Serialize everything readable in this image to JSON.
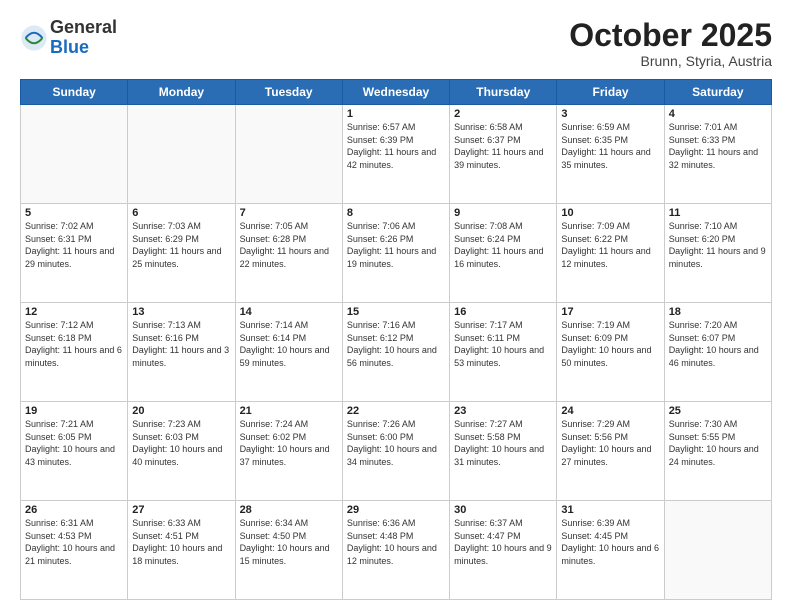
{
  "header": {
    "logo_general": "General",
    "logo_blue": "Blue",
    "month": "October 2025",
    "location": "Brunn, Styria, Austria"
  },
  "days_of_week": [
    "Sunday",
    "Monday",
    "Tuesday",
    "Wednesday",
    "Thursday",
    "Friday",
    "Saturday"
  ],
  "weeks": [
    [
      {
        "day": "",
        "info": ""
      },
      {
        "day": "",
        "info": ""
      },
      {
        "day": "",
        "info": ""
      },
      {
        "day": "1",
        "info": "Sunrise: 6:57 AM\nSunset: 6:39 PM\nDaylight: 11 hours\nand 42 minutes."
      },
      {
        "day": "2",
        "info": "Sunrise: 6:58 AM\nSunset: 6:37 PM\nDaylight: 11 hours\nand 39 minutes."
      },
      {
        "day": "3",
        "info": "Sunrise: 6:59 AM\nSunset: 6:35 PM\nDaylight: 11 hours\nand 35 minutes."
      },
      {
        "day": "4",
        "info": "Sunrise: 7:01 AM\nSunset: 6:33 PM\nDaylight: 11 hours\nand 32 minutes."
      }
    ],
    [
      {
        "day": "5",
        "info": "Sunrise: 7:02 AM\nSunset: 6:31 PM\nDaylight: 11 hours\nand 29 minutes."
      },
      {
        "day": "6",
        "info": "Sunrise: 7:03 AM\nSunset: 6:29 PM\nDaylight: 11 hours\nand 25 minutes."
      },
      {
        "day": "7",
        "info": "Sunrise: 7:05 AM\nSunset: 6:28 PM\nDaylight: 11 hours\nand 22 minutes."
      },
      {
        "day": "8",
        "info": "Sunrise: 7:06 AM\nSunset: 6:26 PM\nDaylight: 11 hours\nand 19 minutes."
      },
      {
        "day": "9",
        "info": "Sunrise: 7:08 AM\nSunset: 6:24 PM\nDaylight: 11 hours\nand 16 minutes."
      },
      {
        "day": "10",
        "info": "Sunrise: 7:09 AM\nSunset: 6:22 PM\nDaylight: 11 hours\nand 12 minutes."
      },
      {
        "day": "11",
        "info": "Sunrise: 7:10 AM\nSunset: 6:20 PM\nDaylight: 11 hours\nand 9 minutes."
      }
    ],
    [
      {
        "day": "12",
        "info": "Sunrise: 7:12 AM\nSunset: 6:18 PM\nDaylight: 11 hours\nand 6 minutes."
      },
      {
        "day": "13",
        "info": "Sunrise: 7:13 AM\nSunset: 6:16 PM\nDaylight: 11 hours\nand 3 minutes."
      },
      {
        "day": "14",
        "info": "Sunrise: 7:14 AM\nSunset: 6:14 PM\nDaylight: 10 hours\nand 59 minutes."
      },
      {
        "day": "15",
        "info": "Sunrise: 7:16 AM\nSunset: 6:12 PM\nDaylight: 10 hours\nand 56 minutes."
      },
      {
        "day": "16",
        "info": "Sunrise: 7:17 AM\nSunset: 6:11 PM\nDaylight: 10 hours\nand 53 minutes."
      },
      {
        "day": "17",
        "info": "Sunrise: 7:19 AM\nSunset: 6:09 PM\nDaylight: 10 hours\nand 50 minutes."
      },
      {
        "day": "18",
        "info": "Sunrise: 7:20 AM\nSunset: 6:07 PM\nDaylight: 10 hours\nand 46 minutes."
      }
    ],
    [
      {
        "day": "19",
        "info": "Sunrise: 7:21 AM\nSunset: 6:05 PM\nDaylight: 10 hours\nand 43 minutes."
      },
      {
        "day": "20",
        "info": "Sunrise: 7:23 AM\nSunset: 6:03 PM\nDaylight: 10 hours\nand 40 minutes."
      },
      {
        "day": "21",
        "info": "Sunrise: 7:24 AM\nSunset: 6:02 PM\nDaylight: 10 hours\nand 37 minutes."
      },
      {
        "day": "22",
        "info": "Sunrise: 7:26 AM\nSunset: 6:00 PM\nDaylight: 10 hours\nand 34 minutes."
      },
      {
        "day": "23",
        "info": "Sunrise: 7:27 AM\nSunset: 5:58 PM\nDaylight: 10 hours\nand 31 minutes."
      },
      {
        "day": "24",
        "info": "Sunrise: 7:29 AM\nSunset: 5:56 PM\nDaylight: 10 hours\nand 27 minutes."
      },
      {
        "day": "25",
        "info": "Sunrise: 7:30 AM\nSunset: 5:55 PM\nDaylight: 10 hours\nand 24 minutes."
      }
    ],
    [
      {
        "day": "26",
        "info": "Sunrise: 6:31 AM\nSunset: 4:53 PM\nDaylight: 10 hours\nand 21 minutes."
      },
      {
        "day": "27",
        "info": "Sunrise: 6:33 AM\nSunset: 4:51 PM\nDaylight: 10 hours\nand 18 minutes."
      },
      {
        "day": "28",
        "info": "Sunrise: 6:34 AM\nSunset: 4:50 PM\nDaylight: 10 hours\nand 15 minutes."
      },
      {
        "day": "29",
        "info": "Sunrise: 6:36 AM\nSunset: 4:48 PM\nDaylight: 10 hours\nand 12 minutes."
      },
      {
        "day": "30",
        "info": "Sunrise: 6:37 AM\nSunset: 4:47 PM\nDaylight: 10 hours\nand 9 minutes."
      },
      {
        "day": "31",
        "info": "Sunrise: 6:39 AM\nSunset: 4:45 PM\nDaylight: 10 hours\nand 6 minutes."
      },
      {
        "day": "",
        "info": ""
      }
    ]
  ]
}
